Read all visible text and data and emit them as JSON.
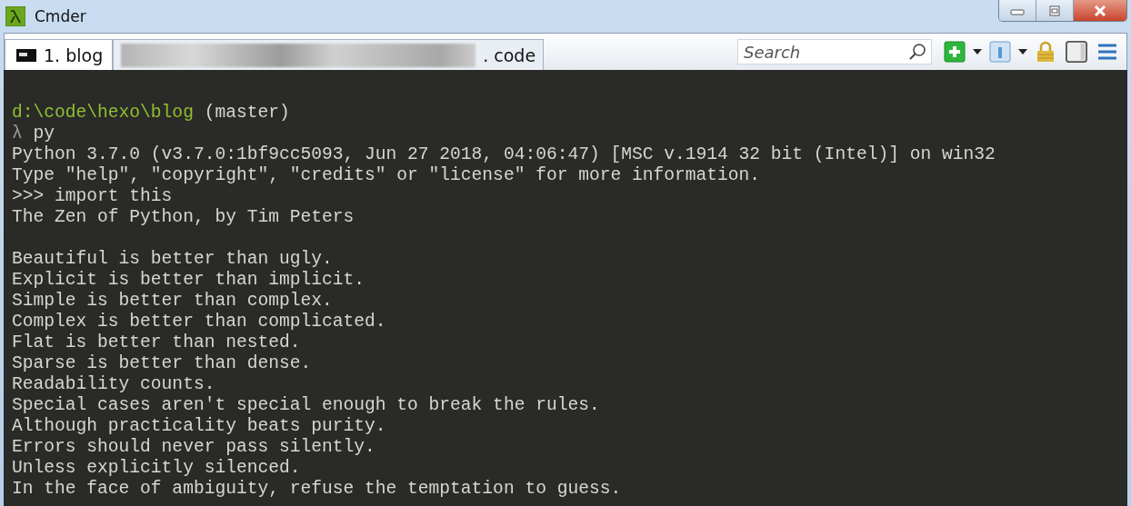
{
  "window": {
    "title": "Cmder"
  },
  "tabs": [
    {
      "label": "1. blog",
      "selected": true,
      "kind": "console"
    },
    {
      "label": ". code",
      "selected": false,
      "kind": "redacted"
    }
  ],
  "toolbar": {
    "search": {
      "placeholder": "Search"
    }
  },
  "terminal": {
    "lines": [
      {
        "kind": "prompt",
        "path": "d:\\code\\hexo\\blog",
        "branch": "(master)"
      },
      {
        "kind": "command",
        "prompt": "λ",
        "text": "py"
      },
      {
        "kind": "output",
        "text": "Python 3.7.0 (v3.7.0:1bf9cc5093, Jun 27 2018, 04:06:47) [MSC v.1914 32 bit (Intel)] on win32"
      },
      {
        "kind": "output",
        "text": "Type \"help\", \"copyright\", \"credits\" or \"license\" for more information."
      },
      {
        "kind": "output",
        "text": ">>> import this"
      },
      {
        "kind": "output",
        "text": "The Zen of Python, by Tim Peters"
      },
      {
        "kind": "blank"
      },
      {
        "kind": "output",
        "text": "Beautiful is better than ugly."
      },
      {
        "kind": "output",
        "text": "Explicit is better than implicit."
      },
      {
        "kind": "output",
        "text": "Simple is better than complex."
      },
      {
        "kind": "output",
        "text": "Complex is better than complicated."
      },
      {
        "kind": "output",
        "text": "Flat is better than nested."
      },
      {
        "kind": "output",
        "text": "Sparse is better than dense."
      },
      {
        "kind": "output",
        "text": "Readability counts."
      },
      {
        "kind": "output",
        "text": "Special cases aren't special enough to break the rules."
      },
      {
        "kind": "output",
        "text": "Although practicality beats purity."
      },
      {
        "kind": "output",
        "text": "Errors should never pass silently."
      },
      {
        "kind": "output",
        "text": "Unless explicitly silenced."
      },
      {
        "kind": "output",
        "text": "In the face of ambiguity, refuse the temptation to guess."
      }
    ]
  }
}
